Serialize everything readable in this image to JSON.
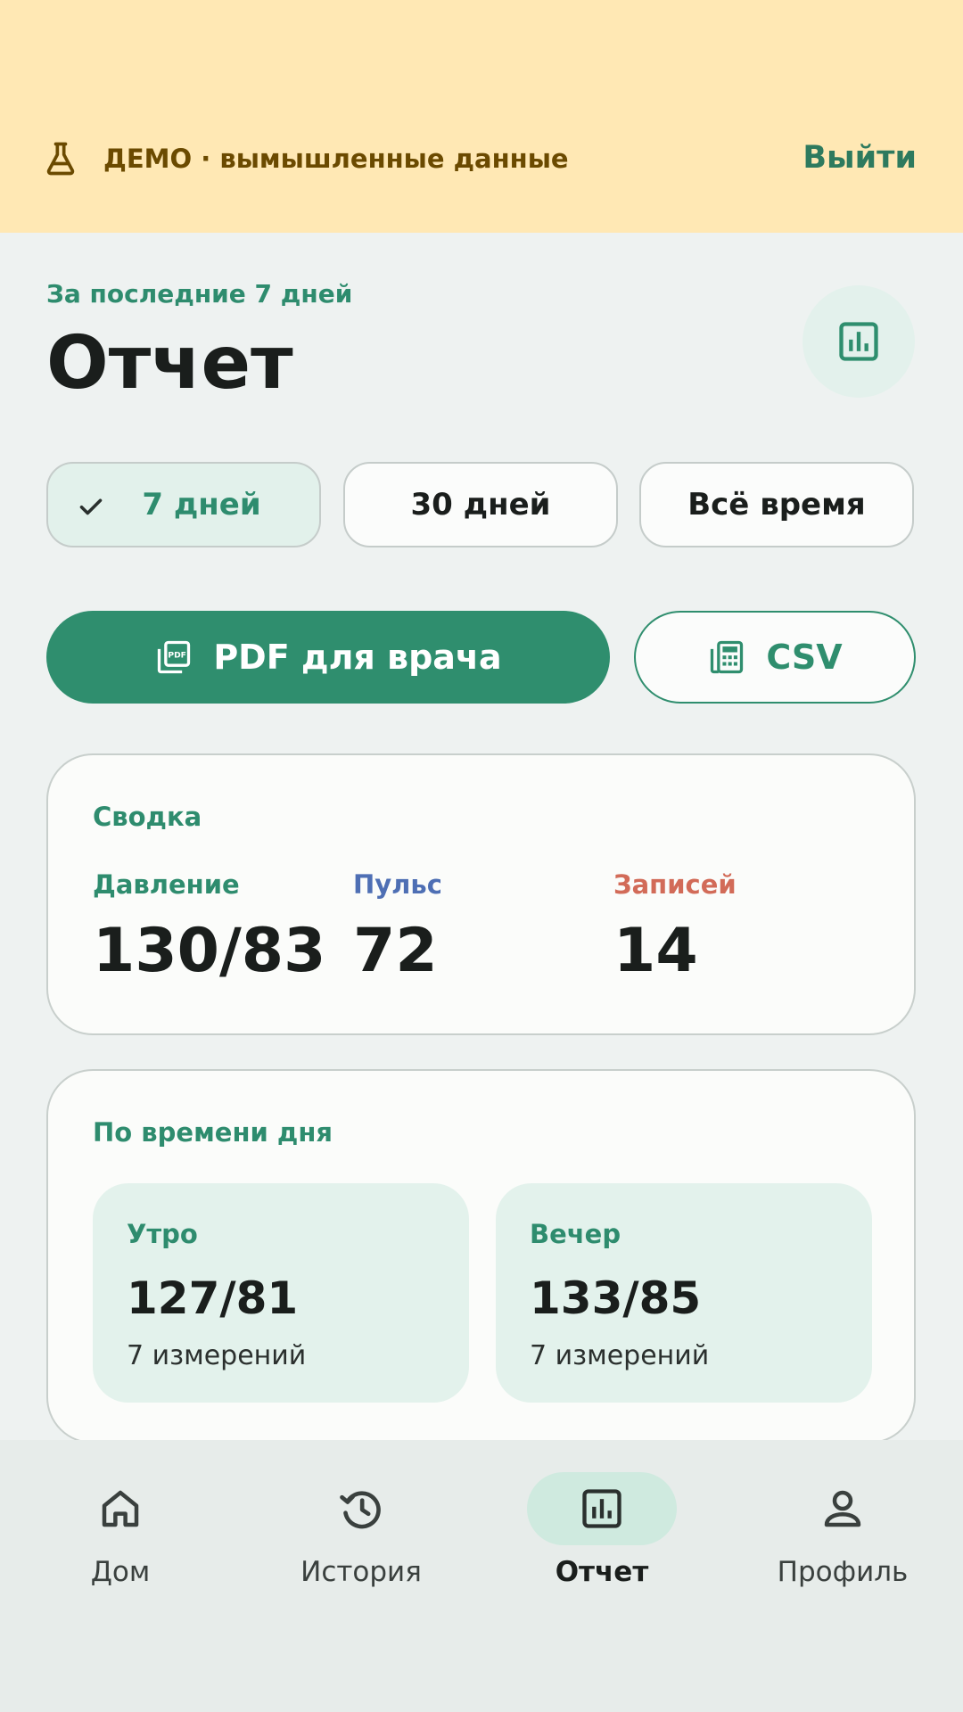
{
  "banner": {
    "flask_icon": "flask-icon",
    "text": "ДЕМО · вымышленные данные",
    "logout_label": "Выйти"
  },
  "header": {
    "subtitle": "За последние 7 дней",
    "title": "Отчет",
    "badge_icon": "bar-chart-icon"
  },
  "period_filter": {
    "options": [
      {
        "label": "7 дней",
        "selected": true
      },
      {
        "label": "30 дней",
        "selected": false
      },
      {
        "label": "Всё время",
        "selected": false
      }
    ]
  },
  "export": {
    "pdf_label": "PDF для врача",
    "csv_label": "CSV"
  },
  "summary": {
    "title": "Сводка",
    "stats": [
      {
        "label": "Давление",
        "value": "130/83",
        "color": "#2E8C6E"
      },
      {
        "label": "Пульс",
        "value": "72",
        "color": "#4E6FB4"
      },
      {
        "label": "Записей",
        "value": "14",
        "color": "#D26B58"
      }
    ]
  },
  "time_of_day": {
    "title": "По времени дня",
    "tiles": [
      {
        "label": "Утро",
        "value": "127/81",
        "count": "7 измерений"
      },
      {
        "label": "Вечер",
        "value": "133/85",
        "count": "7 измерений"
      }
    ]
  },
  "nav": {
    "items": [
      {
        "label": "Дом",
        "icon": "home-icon",
        "active": false
      },
      {
        "label": "История",
        "icon": "history-icon",
        "active": false
      },
      {
        "label": "Отчет",
        "icon": "bar-chart-icon",
        "active": true
      },
      {
        "label": "Профиль",
        "icon": "person-icon",
        "active": false
      }
    ]
  },
  "colors": {
    "accent": "#2F8E6E",
    "banner_bg": "#FFE8B4",
    "background": "#EEF2F1"
  }
}
